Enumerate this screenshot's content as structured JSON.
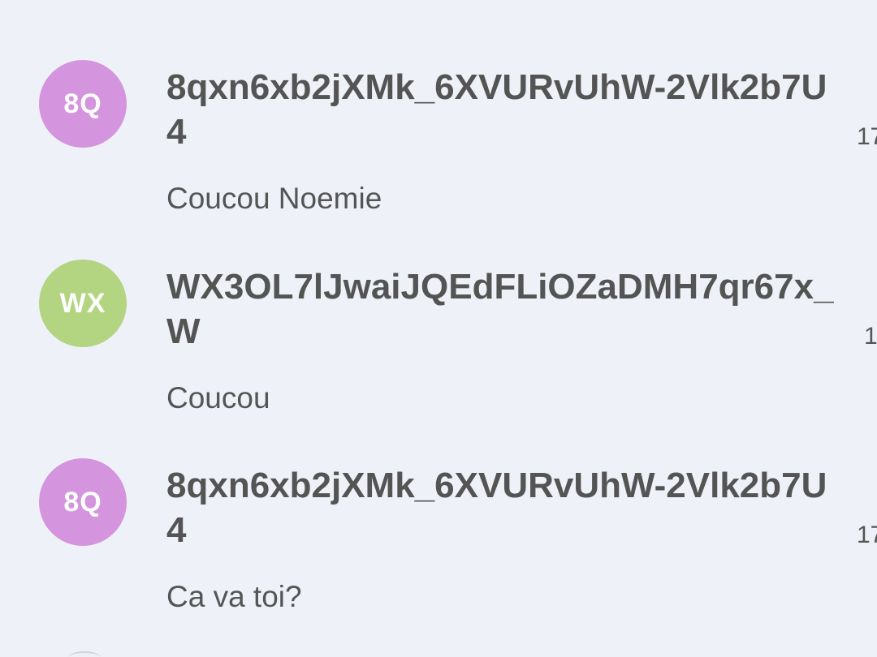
{
  "messages": [
    {
      "avatar_initials": "8Q",
      "avatar_color": "#d494de",
      "sender": "8qxn6xb2jXMk_6XVURvUhW-2Vlk2b7U4",
      "timestamp": "17",
      "text": "Coucou Noemie"
    },
    {
      "avatar_initials": "WX",
      "avatar_color": "#b3d582",
      "sender": "WX3OL7lJwaiJQEdFLiOZaDMH7qr67x_W",
      "timestamp": "1",
      "text": "Coucou"
    },
    {
      "avatar_initials": "8Q",
      "avatar_color": "#d494de",
      "sender": "8qxn6xb2jXMk_6XVURvUhW-2Vlk2b7U4",
      "timestamp": "17",
      "text": "Ca va toi?"
    }
  ]
}
